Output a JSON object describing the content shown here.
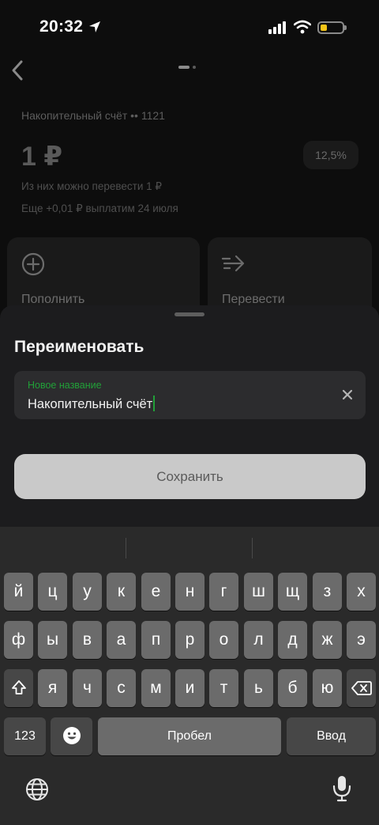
{
  "status_bar": {
    "time": "20:32"
  },
  "account": {
    "name": "Накопительный счёт •• 1121",
    "balance": "1 ₽",
    "rate": "12,5%",
    "available": "Из них можно перевести 1 ₽",
    "extra": "Еще +0,01 ₽ выплатим 24 июля"
  },
  "actions": [
    {
      "label": "Пополнить"
    },
    {
      "label": "Перевести"
    }
  ],
  "sheet": {
    "title": "Переименовать",
    "field_label": "Новое название",
    "field_value": "Накопительный счёт",
    "save_label": "Сохранить"
  },
  "keyboard": {
    "row1": [
      "й",
      "ц",
      "у",
      "к",
      "е",
      "н",
      "г",
      "ш",
      "щ",
      "з",
      "х"
    ],
    "row2": [
      "ф",
      "ы",
      "в",
      "а",
      "п",
      "р",
      "о",
      "л",
      "д",
      "ж",
      "э"
    ],
    "row3": [
      "я",
      "ч",
      "с",
      "м",
      "и",
      "т",
      "ь",
      "б",
      "ю"
    ],
    "numbers_label": "123",
    "space_label": "Пробел",
    "return_label": "Ввод"
  }
}
